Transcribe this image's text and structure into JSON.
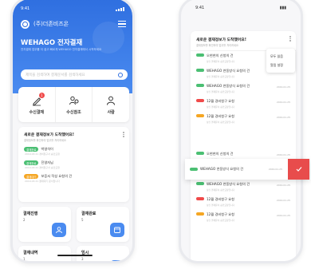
{
  "left": {
    "status": {
      "time": "9:41"
    },
    "company": "(주)더존비즈온",
    "title": "WEHAGO 전자결재",
    "subtitle": "전자결재 업무를 더 쉽고 빠르게 WEHAGO 전자결재에서 시작하세요",
    "search_placeholder": "제목을 검색하여 결재문서를 검색하세요",
    "quick": [
      {
        "label": "수신결재",
        "badge": "1"
      },
      {
        "label": "수신참조",
        "badge": ""
      },
      {
        "label": "사람",
        "badge": ""
      }
    ],
    "notice": {
      "title": "새로운 결재정보가 도착했어요!",
      "subtitle": "결재정보를 확인하여 업무를 처리하세요",
      "rows": [
        {
          "pill": "결재완료",
          "text": "박영석이",
          "meta": "2019.03.21 경비청구서 승인요청"
        },
        {
          "pill": "결재완료",
          "text": "진영자님",
          "meta": "2019.03.21 경비청구서 승인요청"
        },
        {
          "pill": "결재대기",
          "text": "보증서 작성 요청의 건",
          "meta": "2019.03.21 결재대기 문서입니다"
        }
      ]
    },
    "tiles": [
      {
        "title": "결재진행",
        "count": "2"
      },
      {
        "title": "결재완료",
        "count": "5"
      },
      {
        "title": "결재내역",
        "count": "1"
      },
      {
        "title": "임시",
        "count": "3"
      }
    ]
  },
  "right": {
    "status": {
      "time": "9:41"
    },
    "head_title": "새로운 결재정보가 도착했어요!",
    "head_sub": "결재정보를 확인하여 업무를 처리하세요",
    "menu": [
      "모두 읽음",
      "알림 설정"
    ],
    "items": [
      {
        "pill": "g",
        "text": "오현현의 신청의 건",
        "sm": "상신 결재문서 승인요청입니다",
        "date": "2019.01.25"
      },
      {
        "pill": "g",
        "text": "WEHAGO 연동방식 요청의 건",
        "sm": "상신 결재문서 승인요청입니다",
        "date": "2019.01.25"
      },
      {
        "pill": "g",
        "text": "WEHAGO 연동방식 요청의 건",
        "sm": "상신 결재문서 승인요청입니다",
        "date": "2019.01.25"
      },
      {
        "pill": "r",
        "text": "12월 경비청구 요청",
        "sm": "상신 결재문서 승인요청입니다",
        "date": "2019.01.25"
      },
      {
        "pill": "o",
        "text": "12월 경비청구 요청",
        "sm": "상신 결재문서 승인요청입니다",
        "date": "2019.01.25"
      }
    ],
    "swipe": {
      "text": "WEHAGO 연동방식 요청의 건",
      "date": "2019.01.25"
    },
    "items2": [
      {
        "pill": "g",
        "text": "오현현의 신청의 건",
        "sm": "상신 결재문서 승인요청입니다",
        "date": "2019.01.25"
      },
      {
        "pill": "g",
        "text": "WEHAGO 연동방식 요청의 건",
        "sm": "상신 결재문서 승인요청입니다",
        "date": "2019.01.25"
      },
      {
        "pill": "g",
        "text": "WEHAGO 연동방식 요청의 건",
        "sm": "상신 결재문서 승인요청입니다",
        "date": "2019.01.25"
      },
      {
        "pill": "r",
        "text": "12월 경비청구 요청",
        "sm": "상신 결재문서 승인요청입니다",
        "date": "2019.01.25"
      },
      {
        "pill": "o",
        "text": "12월 경비청구 요청",
        "sm": "상신 결재문서 승인요청입니다",
        "date": "2019.01.25"
      }
    ]
  }
}
